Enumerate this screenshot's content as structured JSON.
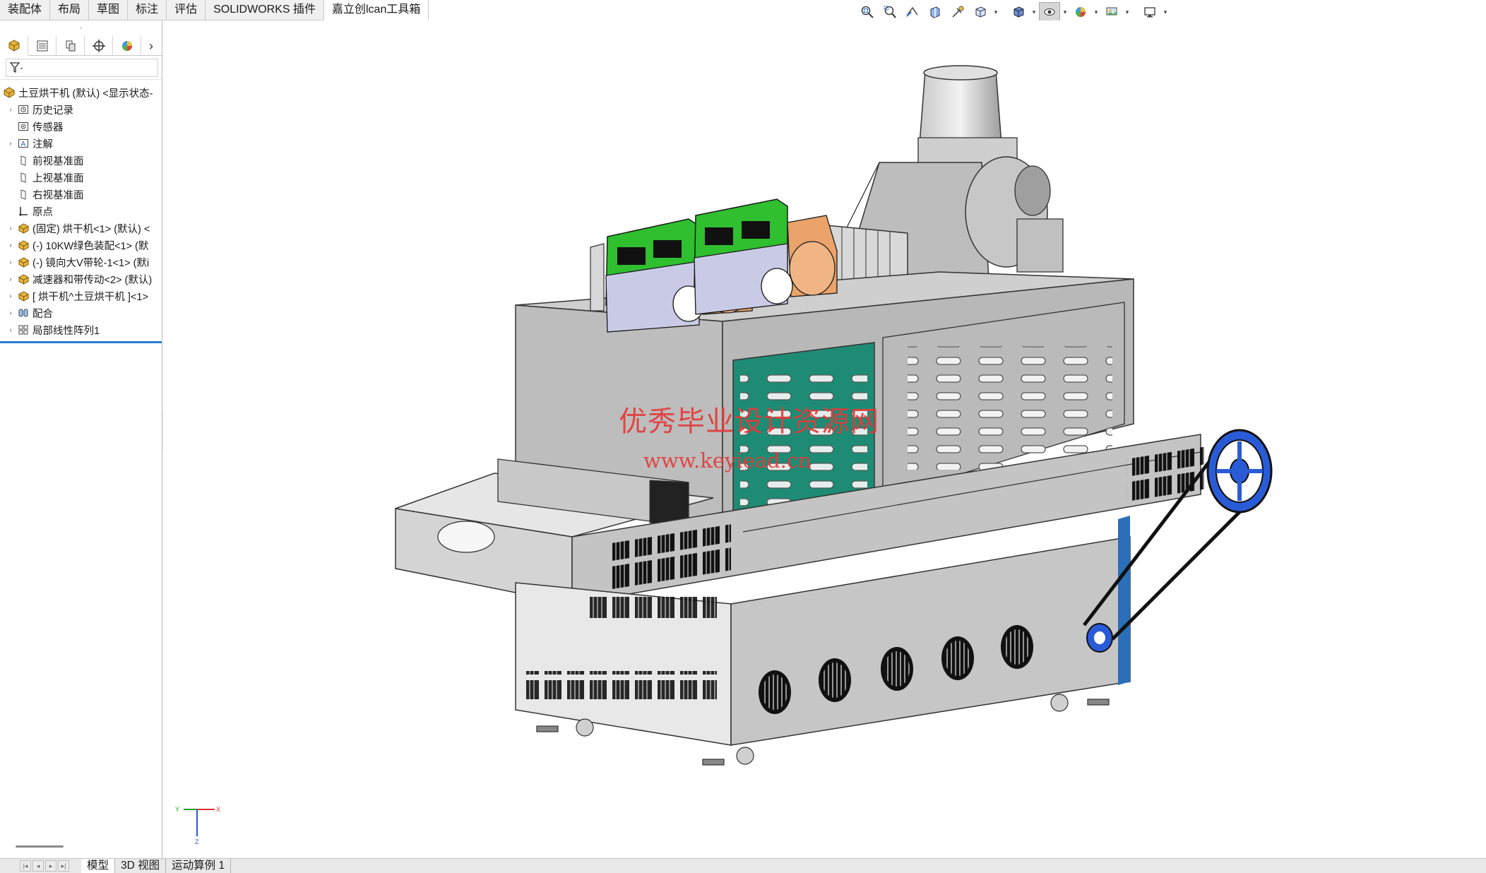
{
  "command_tabs": [
    {
      "label": "装配体",
      "active": false
    },
    {
      "label": "布局",
      "active": false
    },
    {
      "label": "草图",
      "active": false
    },
    {
      "label": "标注",
      "active": false
    },
    {
      "label": "评估",
      "active": false
    },
    {
      "label": "SOLIDWORKS 插件",
      "active": false
    },
    {
      "label": "嘉立创lcan工具箱",
      "active": true
    }
  ],
  "heads_up_toolbar": [
    {
      "icon": "zoom-to-fit-icon"
    },
    {
      "icon": "zoom-to-area-icon"
    },
    {
      "icon": "previous-view-icon"
    },
    {
      "icon": "section-view-icon"
    },
    {
      "icon": "dynamic-annotation-icon"
    },
    {
      "icon": "view-orientation-icon"
    },
    {
      "icon": "display-style-icon"
    },
    {
      "icon": "hide-show-items-icon"
    },
    {
      "icon": "edit-appearance-icon"
    },
    {
      "icon": "apply-scene-icon"
    },
    {
      "icon": "view-settings-icon"
    }
  ],
  "panel_tabs": [
    {
      "icon": "featuremanager-tree-icon"
    },
    {
      "icon": "property-manager-icon"
    },
    {
      "icon": "configuration-manager-icon"
    },
    {
      "icon": "dimxpert-manager-icon"
    },
    {
      "icon": "display-manager-icon"
    }
  ],
  "filter": {
    "icon": "filter-icon"
  },
  "tree": {
    "root": {
      "label": "土豆烘干机 (默认) <显示状态-",
      "icon": "assembly-icon"
    },
    "items": [
      {
        "label": "历史记录",
        "icon": "history-icon",
        "expandable": true
      },
      {
        "label": "传感器",
        "icon": "sensor-icon",
        "expandable": false
      },
      {
        "label": "注解",
        "icon": "annotation-icon",
        "expandable": true
      },
      {
        "label": "前视基准面",
        "icon": "plane-icon",
        "expandable": false
      },
      {
        "label": "上视基准面",
        "icon": "plane-icon",
        "expandable": false
      },
      {
        "label": "右视基准面",
        "icon": "plane-icon",
        "expandable": false
      },
      {
        "label": "原点",
        "icon": "origin-icon",
        "expandable": false
      },
      {
        "label": "(固定) 烘干机<1> (默认) <",
        "icon": "subassembly-icon",
        "expandable": true
      },
      {
        "label": "(-) 10KW绿色装配<1> (默",
        "icon": "subassembly-icon",
        "expandable": true
      },
      {
        "label": "(-) 镜向大V带轮-1<1> (默i",
        "icon": "subassembly-icon",
        "expandable": true
      },
      {
        "label": "减速器和带传动<2> (默认)",
        "icon": "subassembly-icon",
        "expandable": true
      },
      {
        "label": "[ 烘干机^土豆烘干机 ]<1>",
        "icon": "subassembly-icon",
        "expandable": true
      },
      {
        "label": "配合",
        "icon": "mates-icon",
        "expandable": true
      },
      {
        "label": "局部线性阵列1",
        "icon": "linear-pattern-icon",
        "expandable": true
      }
    ]
  },
  "graphics": {
    "watermark_cn": "优秀毕业设计资源网",
    "watermark_url": "www.keyiead.cn",
    "triad": {
      "x_label": "X",
      "y_label": "Y",
      "z_label": "Z"
    },
    "colors": {
      "machine_gray": "#b9b9b9",
      "panel_green": "#1e8c74",
      "heater_green": "#2fbf2f",
      "blower_orange": "#e9a36b",
      "accent_blue": "#2a5bd7",
      "watermark_red": "#e53a3a"
    }
  },
  "bottom_tabs": [
    {
      "label": "模型",
      "active": true
    },
    {
      "label": "3D 视图",
      "active": false
    },
    {
      "label": "运动算例 1",
      "active": false
    }
  ]
}
